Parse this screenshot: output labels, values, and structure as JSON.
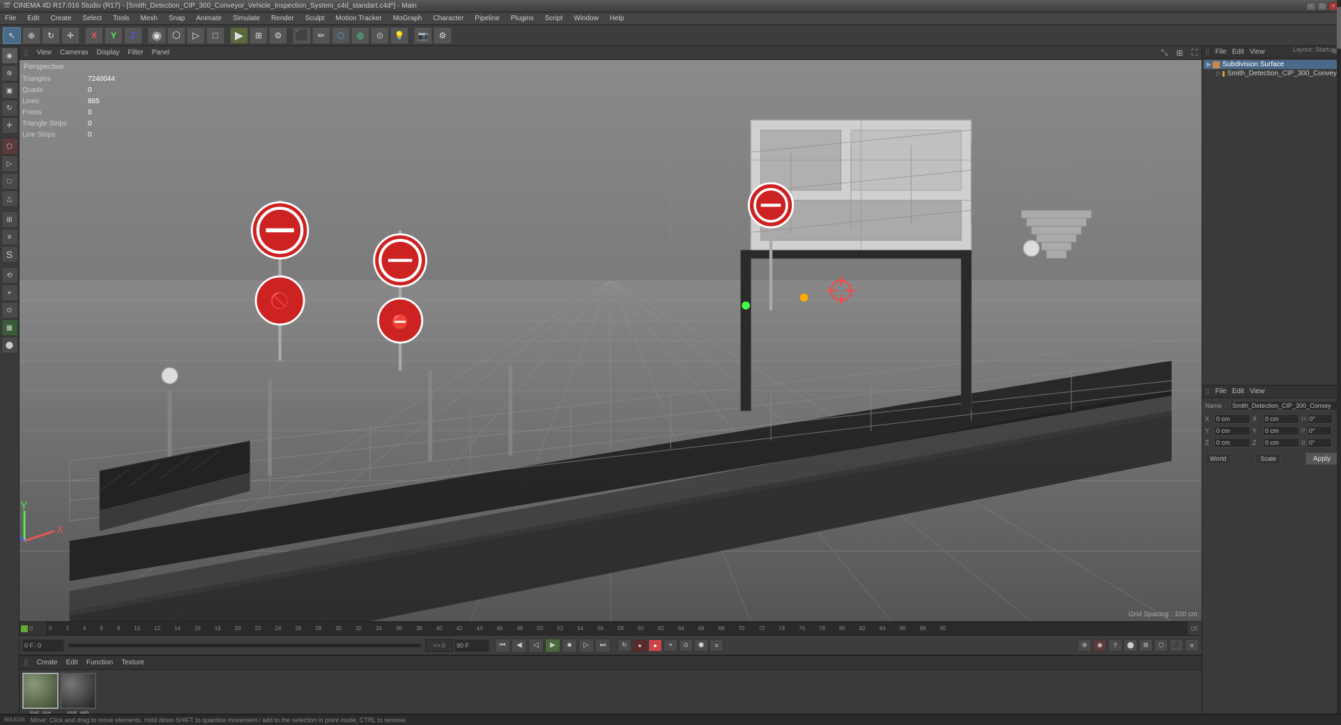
{
  "titlebar": {
    "title": "CINEMA 4D R17.016 Studio (R17) - [Smith_Detection_CIP_300_Conveyor_Vehicle_Inspection_System_c4d_standart.c4d*] - Main",
    "min": "–",
    "max": "□",
    "close": "×"
  },
  "menu": {
    "items": [
      "File",
      "Edit",
      "Create",
      "Select",
      "Tools",
      "Mesh",
      "Snap",
      "Animate",
      "Simulate",
      "Render",
      "Sculpt",
      "Motion Tracker",
      "MoGraph",
      "Character",
      "Pipeline",
      "Plugins",
      "Script",
      "Window",
      "Help"
    ]
  },
  "toolbar": {
    "mode_buttons": [
      "↑",
      "⊕",
      "□",
      "↻",
      "✛"
    ],
    "axis_buttons": [
      "X",
      "Y",
      "Z"
    ],
    "transform_buttons": [
      "◎",
      "⇄",
      "⟲",
      "✛"
    ],
    "tool_buttons": [
      "✏",
      "⬡",
      "◎",
      "⊙",
      "💡"
    ]
  },
  "viewport": {
    "label": "Perspective",
    "grid_spacing": "Grid Spacing : 100 cm",
    "stats": {
      "triangles_label": "Triangles",
      "triangles_val": "7240044",
      "quads_label": "Quads",
      "quads_val": "0",
      "lines_label": "Lines",
      "lines_val": "885",
      "points_label": "Points",
      "points_val": "0",
      "triangle_strips_label": "Triangle Strips",
      "triangle_strips_val": "0",
      "line_strips_label": "Line Strips",
      "line_strips_val": "0"
    },
    "top_menu": [
      "View",
      "Cameras",
      "Display",
      "Filter",
      "Panel"
    ]
  },
  "timeline": {
    "marks": [
      "0",
      "2",
      "4",
      "6",
      "8",
      "10",
      "12",
      "14",
      "16",
      "18",
      "20",
      "22",
      "24",
      "26",
      "28",
      "30",
      "32",
      "34",
      "36",
      "38",
      "40",
      "42",
      "44",
      "46",
      "48",
      "50",
      "52",
      "54",
      "56",
      "58",
      "60",
      "62",
      "64",
      "66",
      "68",
      "70",
      "72",
      "74",
      "76",
      "78",
      "80",
      "82",
      "84",
      "86",
      "88",
      "90"
    ],
    "current_frame": "0 F",
    "end_frame": "90 F",
    "frame_input": "0",
    "frame_start": "0 F"
  },
  "playback": {
    "fps": "0",
    "end_frame_display": "90 F"
  },
  "material_editor": {
    "menu": [
      "Create",
      "Edit",
      "Function",
      "Texture"
    ],
    "materials": [
      {
        "name": "mat_ove",
        "color": "#7a8a6a"
      },
      {
        "name": "mat_veh",
        "color": "#555555"
      }
    ]
  },
  "right_panel": {
    "top": {
      "menu": [
        "File",
        "Edit",
        "View"
      ],
      "layout_label": "Layout: Startup",
      "tree_items": [
        {
          "label": "Subdivision Surface",
          "icon": "◇",
          "indent": 0,
          "selected": true
        },
        {
          "label": "Smith_Detection_CIP_300_Convey",
          "icon": "▷",
          "indent": 1,
          "selected": false
        }
      ]
    },
    "bottom": {
      "menu": [
        "File",
        "Edit",
        "View"
      ],
      "name_label": "Name",
      "object_name": "Smith_Detection_CIP_300_Convey",
      "coords": {
        "x_pos": "0 cm",
        "y_pos": "0 cm",
        "z_pos": "0 cm",
        "x_rot": "0°",
        "y_rot": "0°",
        "z_rot": "0°",
        "x_scale": "0 cm",
        "y_scale": "0 cm",
        "z_scale": "0 cm",
        "h": "0°",
        "p": "0°",
        "b": "0°"
      },
      "buttons": {
        "world": "World",
        "scale": "Scale",
        "apply": "Apply"
      }
    }
  },
  "status_bar": {
    "text": "Move: Click and drag to move elements. Hold down SHIFT to quantize movement / add to the selection in point mode, CTRL to remove."
  },
  "icons": {
    "play": "▶",
    "pause": "⏸",
    "stop": "■",
    "prev": "◀",
    "next": "▶",
    "first": "⏮",
    "last": "⏭",
    "record": "●"
  }
}
